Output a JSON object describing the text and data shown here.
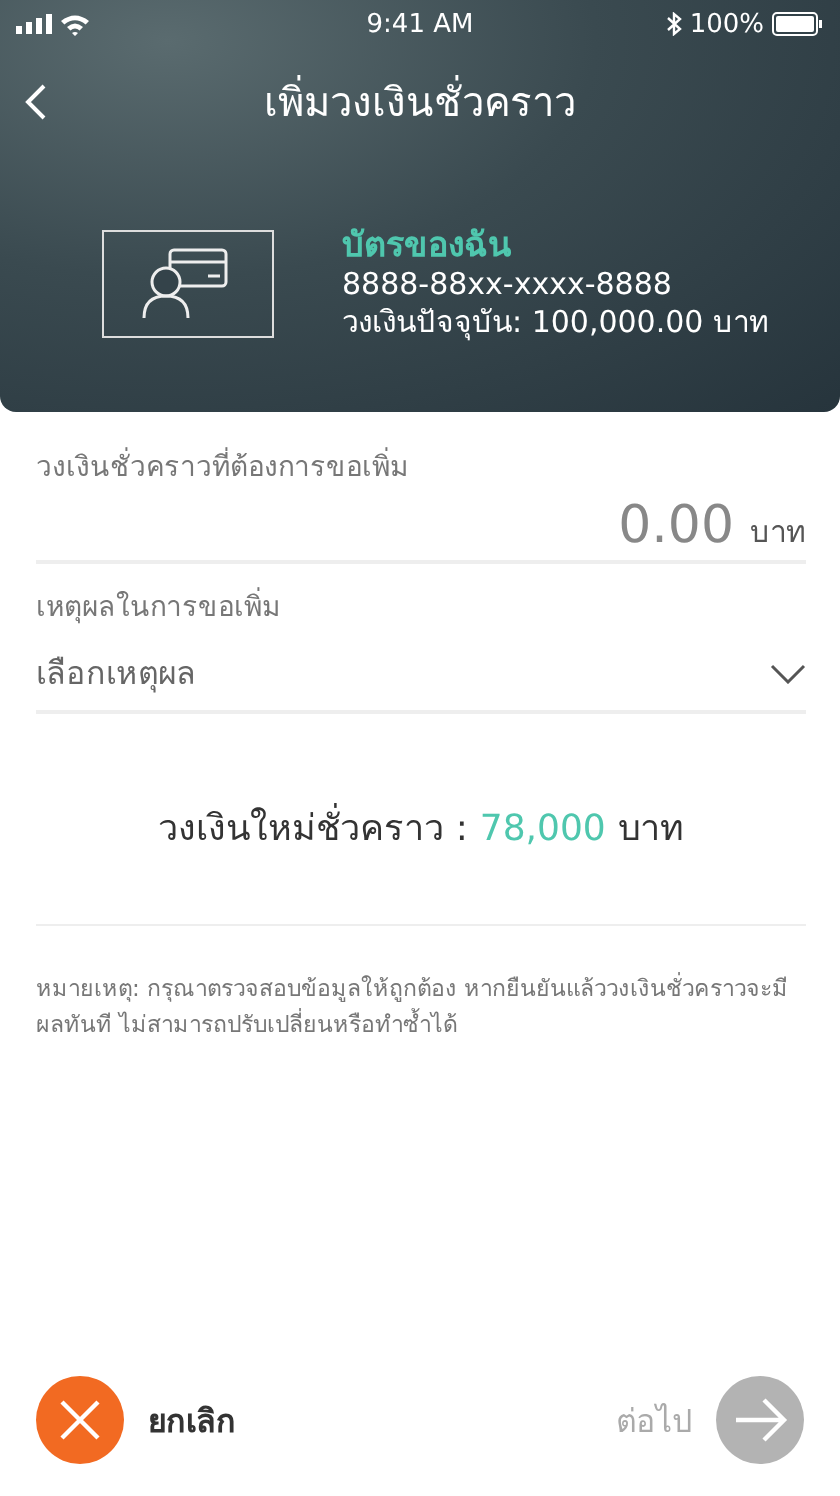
{
  "status_bar": {
    "time": "9:41 AM",
    "battery": "100%"
  },
  "header": {
    "title": "เพิ่มวงเงินชั่วคราว"
  },
  "card": {
    "name": "บัตรของฉัน",
    "number": "8888-88xx-xxxx-8888",
    "current_limit": "วงเงินปัจจุบัน: 100,000.00 บาท"
  },
  "amount_field": {
    "label": "วงเงินชั่วคราวที่ต้องการขอเพิ่ม",
    "value": "0.00",
    "unit": "บาท"
  },
  "reason_field": {
    "label": "เหตุผลในการขอเพิ่ม",
    "placeholder": "เลือกเหตุผล"
  },
  "new_limit": {
    "label": "วงเงินใหม่ชั่วคราว :",
    "amount": "78,000",
    "unit": "บาท"
  },
  "note": "หมายเหตุ: กรุณาตรวจสอบข้อมูลให้ถูกต้อง หากยืนยันแล้ววงเงินชั่วคราวจะมีผลทันที ไม่สามารถปรับเปลี่ยนหรือทำซ้ำได้",
  "footer": {
    "cancel": {
      "label": "ยกเลิก",
      "disabled": false
    },
    "next": {
      "label": "ต่อไป",
      "disabled": true
    }
  }
}
